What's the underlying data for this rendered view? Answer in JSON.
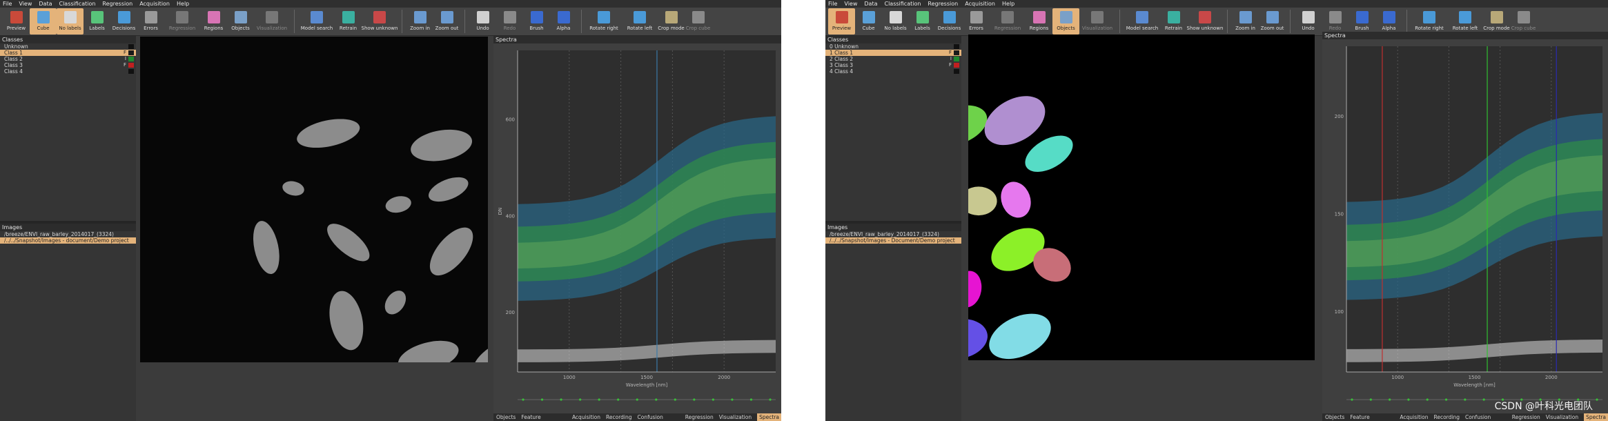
{
  "menu": [
    "File",
    "View",
    "Data",
    "Classification",
    "Regression",
    "Acquisition",
    "Help"
  ],
  "left_window": {
    "toolbar": [
      {
        "label": "Preview",
        "icon": "preview-icon",
        "color": "#c94a3a",
        "state": "normal"
      },
      {
        "label": "Cube",
        "icon": "cube-icon",
        "color": "#5aa0d8",
        "state": "active"
      },
      {
        "label": "No labels",
        "icon": "no-labels-icon",
        "color": "#d8d8d8",
        "state": "active"
      },
      {
        "label": "Labels",
        "icon": "labels-icon",
        "color": "#58c47a",
        "state": "normal"
      },
      {
        "label": "Decisions",
        "icon": "decisions-icon",
        "color": "#4a9ad8",
        "state": "normal"
      },
      {
        "label": "Errors",
        "icon": "errors-icon",
        "color": "#9a9a9a",
        "state": "normal"
      },
      {
        "label": "Regression",
        "icon": "regression-icon",
        "color": "#777777",
        "state": "disabled"
      },
      {
        "label": "Regions",
        "icon": "regions-icon",
        "color": "#d874b4",
        "state": "normal"
      },
      {
        "label": "Objects",
        "icon": "objects-icon",
        "color": "#7aa0c8",
        "state": "normal"
      },
      {
        "label": "Visualization",
        "icon": "visualization-icon",
        "color": "#777777",
        "state": "disabled"
      },
      {
        "sep": true
      },
      {
        "label": "Model search",
        "icon": "model-search-icon",
        "color": "#5a8ad0",
        "state": "normal"
      },
      {
        "label": "Retrain",
        "icon": "retrain-icon",
        "color": "#3ab0a0",
        "state": "normal"
      },
      {
        "label": "Show unknown",
        "icon": "show-unknown-icon",
        "color": "#c84848",
        "state": "normal"
      },
      {
        "sep": true
      },
      {
        "label": "Zoom in",
        "icon": "zoom-in-icon",
        "color": "#6a9ad0",
        "state": "normal"
      },
      {
        "label": "Zoom out",
        "icon": "zoom-out-icon",
        "color": "#6a9ad0",
        "state": "normal"
      },
      {
        "sep": true
      },
      {
        "label": "Undo",
        "icon": "undo-icon",
        "color": "#d0d0d0",
        "state": "normal"
      },
      {
        "label": "Redo",
        "icon": "redo-icon",
        "color": "#8a8a8a",
        "state": "disabled"
      },
      {
        "label": "Brush",
        "icon": "brush-icon",
        "color": "#3a6ad0",
        "state": "normal"
      },
      {
        "label": "Alpha",
        "icon": "alpha-icon",
        "color": "#3a6ad0",
        "state": "normal"
      },
      {
        "sep": true
      },
      {
        "label": "Rotate right",
        "icon": "rotate-right-icon",
        "color": "#4a9ad8",
        "state": "normal"
      },
      {
        "label": "Rotate left",
        "icon": "rotate-left-icon",
        "color": "#4a9ad8",
        "state": "normal"
      },
      {
        "label": "Crop mode",
        "icon": "crop-mode-icon",
        "color": "#b8a878",
        "state": "normal"
      },
      {
        "label": "Crop cube",
        "icon": "crop-cube-icon",
        "color": "#8a8a8a",
        "state": "disabled"
      }
    ],
    "classes_header": "Classes",
    "classes": [
      {
        "label": "Unknown",
        "flag": "",
        "color": "#111111",
        "selected": false
      },
      {
        "label": "Class 1",
        "flag": "F",
        "color": "#1a1a1a",
        "selected": true
      },
      {
        "label": "Class 2",
        "flag": "I",
        "color": "#1f8a2f",
        "selected": false
      },
      {
        "label": "Class 3",
        "flag": "F",
        "color": "#c02020",
        "selected": false
      },
      {
        "label": "Class 4",
        "flag": "",
        "color": "#111111",
        "selected": false
      }
    ],
    "images_header": "Images",
    "images": [
      {
        "label": "/breeze/ENVI_raw_barley_2014017_(3324)",
        "selected": false
      },
      {
        "label": "/../../Snapshot/Images - document/Demo project",
        "selected": true
      }
    ],
    "spectra_header": "Spectra",
    "spectra_axis": {
      "y_ticks": [
        "600",
        "400",
        "200"
      ],
      "x_ticks": [
        "1000",
        "1500",
        "2000"
      ],
      "xlabel": "Wavelength [nm]",
      "ylabel": "DN"
    },
    "bottom_tabs": [
      "Objects",
      "Feature extraction",
      "Acquisition",
      "Recording",
      "Confusion matrix",
      "Regression",
      "Visualization",
      "Spectra"
    ],
    "active_tab": "Spectra"
  },
  "right_window": {
    "toolbar": [
      {
        "label": "Preview",
        "icon": "preview-icon",
        "color": "#c94a3a",
        "state": "active"
      },
      {
        "label": "Cube",
        "icon": "cube-icon",
        "color": "#5aa0d8",
        "state": "normal"
      },
      {
        "label": "No labels",
        "icon": "no-labels-icon",
        "color": "#d8d8d8",
        "state": "normal"
      },
      {
        "label": "Labels",
        "icon": "labels-icon",
        "color": "#58c47a",
        "state": "normal"
      },
      {
        "label": "Decisions",
        "icon": "decisions-icon",
        "color": "#4a9ad8",
        "state": "normal"
      },
      {
        "label": "Errors",
        "icon": "errors-icon",
        "color": "#9a9a9a",
        "state": "normal"
      },
      {
        "label": "Regression",
        "icon": "regression-icon",
        "color": "#777777",
        "state": "disabled"
      },
      {
        "label": "Regions",
        "icon": "regions-icon",
        "color": "#d874b4",
        "state": "normal"
      },
      {
        "label": "Objects",
        "icon": "objects-icon",
        "color": "#7aa0c8",
        "state": "active"
      },
      {
        "label": "Visualization",
        "icon": "visualization-icon",
        "color": "#777777",
        "state": "disabled"
      },
      {
        "sep": true
      },
      {
        "label": "Model search",
        "icon": "model-search-icon",
        "color": "#5a8ad0",
        "state": "normal"
      },
      {
        "label": "Retrain",
        "icon": "retrain-icon",
        "color": "#3ab0a0",
        "state": "normal"
      },
      {
        "label": "Show unknown",
        "icon": "show-unknown-icon",
        "color": "#c84848",
        "state": "normal"
      },
      {
        "sep": true
      },
      {
        "label": "Zoom in",
        "icon": "zoom-in-icon",
        "color": "#6a9ad0",
        "state": "normal"
      },
      {
        "label": "Zoom out",
        "icon": "zoom-out-icon",
        "color": "#6a9ad0",
        "state": "normal"
      },
      {
        "sep": true
      },
      {
        "label": "Undo",
        "icon": "undo-icon",
        "color": "#d0d0d0",
        "state": "normal"
      },
      {
        "label": "Redo",
        "icon": "redo-icon",
        "color": "#8a8a8a",
        "state": "disabled"
      },
      {
        "label": "Brush",
        "icon": "brush-icon",
        "color": "#3a6ad0",
        "state": "normal"
      },
      {
        "label": "Alpha",
        "icon": "alpha-icon",
        "color": "#3a6ad0",
        "state": "normal"
      },
      {
        "sep": true
      },
      {
        "label": "Rotate right",
        "icon": "rotate-right-icon",
        "color": "#4a9ad8",
        "state": "normal"
      },
      {
        "label": "Rotate left",
        "icon": "rotate-left-icon",
        "color": "#4a9ad8",
        "state": "normal"
      },
      {
        "label": "Crop mode",
        "icon": "crop-mode-icon",
        "color": "#b8a878",
        "state": "normal"
      },
      {
        "label": "Crop cube",
        "icon": "crop-cube-icon",
        "color": "#8a8a8a",
        "state": "disabled"
      }
    ],
    "classes_header": "Classes",
    "classes": [
      {
        "label": "0  Unknown",
        "flag": "",
        "color": "#111111",
        "selected": false
      },
      {
        "label": "1  Class 1",
        "flag": "F",
        "color": "#1a1a1a",
        "selected": true
      },
      {
        "label": "2  Class 2",
        "flag": "I",
        "color": "#1f8a2f",
        "selected": false
      },
      {
        "label": "3  Class 3",
        "flag": "F",
        "color": "#c02020",
        "selected": false
      },
      {
        "label": "4  Class 4",
        "flag": "",
        "color": "#111111",
        "selected": false
      }
    ],
    "images_header": "Images",
    "images": [
      {
        "label": "/breeze/ENVI_raw_barley_2014017_(3324)",
        "selected": false
      },
      {
        "label": "/../../Snapshot/Images - Document/Demo project",
        "selected": true
      }
    ],
    "spectra_header": "Spectra",
    "spectra_axis": {
      "y_ticks": [
        "200",
        "150",
        "100"
      ],
      "x_ticks": [
        "1000",
        "1500",
        "2000"
      ],
      "xlabel": "Wavelength [nm]",
      "ylabel": ""
    },
    "bottom_tabs": [
      "Objects",
      "Feature extraction",
      "Acquisition",
      "Recording",
      "Confusion matrix",
      "Regression",
      "Visualization",
      "Spectra"
    ],
    "active_tab": "Spectra"
  },
  "object_colors": [
    "#6ed24a",
    "#b08fd0",
    "#56dcc6",
    "#b4be28",
    "#c8c890",
    "#e678ee",
    "#14d2c8",
    "#e48cc8",
    "#8cf028",
    "#c86e78",
    "#2ad2a0",
    "#e614d2",
    "#6450e6",
    "#82dce6"
  ],
  "watermark": "CSDN @叶科光电团队"
}
